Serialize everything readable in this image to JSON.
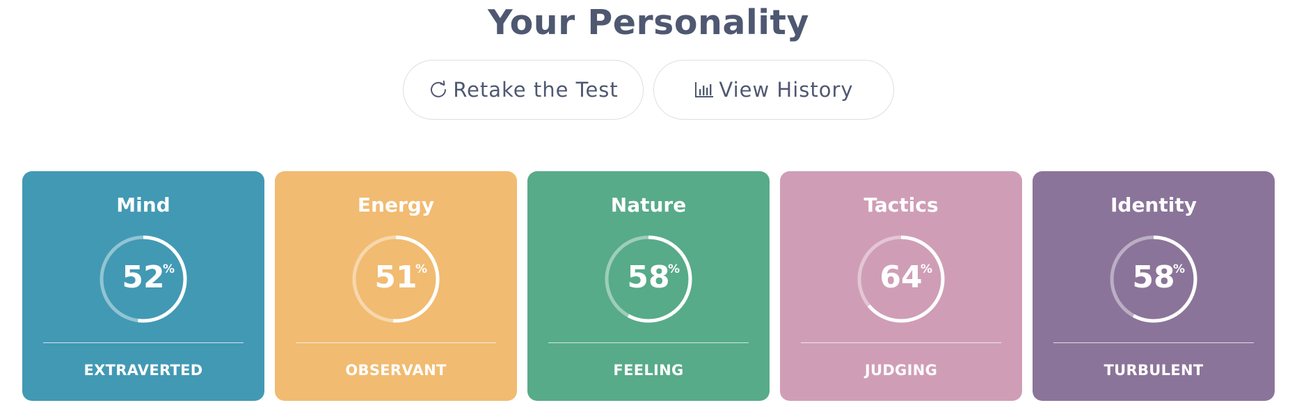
{
  "header": {
    "title": "Your Personality"
  },
  "actions": {
    "retake": {
      "label": "Retake the Test",
      "icon": "refresh-icon"
    },
    "history": {
      "label": "View History",
      "icon": "bar-chart-icon"
    }
  },
  "cards": [
    {
      "title": "Mind",
      "value": "52",
      "percent_sign": "%",
      "trait": "EXTRAVERTED",
      "color": "#4299b4",
      "fraction": 0.52
    },
    {
      "title": "Energy",
      "value": "51",
      "percent_sign": "%",
      "trait": "OBSERVANT",
      "color": "#f1bb71",
      "fraction": 0.51
    },
    {
      "title": "Nature",
      "value": "58",
      "percent_sign": "%",
      "trait": "FEELING",
      "color": "#57ab89",
      "fraction": 0.58
    },
    {
      "title": "Tactics",
      "value": "64",
      "percent_sign": "%",
      "trait": "JUDGING",
      "color": "#cf9eb6",
      "fraction": 0.64
    },
    {
      "title": "Identity",
      "value": "58",
      "percent_sign": "%",
      "trait": "TURBULENT",
      "color": "#8b7499",
      "fraction": 0.58
    }
  ]
}
